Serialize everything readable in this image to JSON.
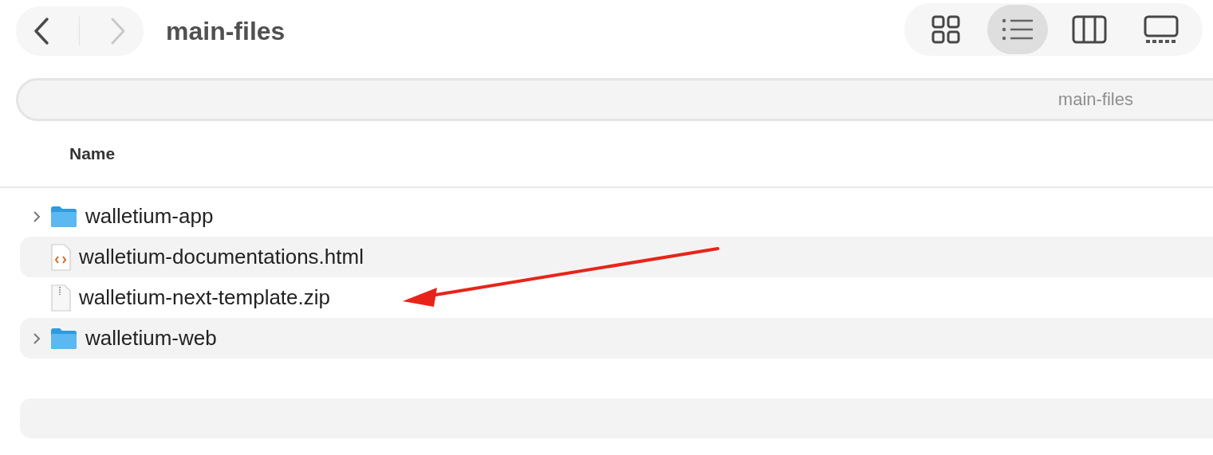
{
  "toolbar": {
    "nav": [
      {
        "kind": "back",
        "disabled": false
      },
      {
        "kind": "forward",
        "disabled": true
      }
    ],
    "title": "main-files",
    "views": [
      {
        "kind": "icons",
        "selected": false
      },
      {
        "kind": "list",
        "selected": true
      },
      {
        "kind": "columns",
        "selected": false
      },
      {
        "kind": "gallery",
        "selected": false
      }
    ]
  },
  "path_bar": {
    "text": "main-files"
  },
  "table": {
    "columns": [
      "Name"
    ],
    "rows": [
      {
        "name": "walletium-app",
        "kind": "folder",
        "expanded": false
      },
      {
        "name": "walletium-documentations.html",
        "kind": "html"
      },
      {
        "name": "walletium-next-template.zip",
        "kind": "zip"
      },
      {
        "name": "walletium-web",
        "kind": "folder",
        "expanded": false
      }
    ]
  }
}
